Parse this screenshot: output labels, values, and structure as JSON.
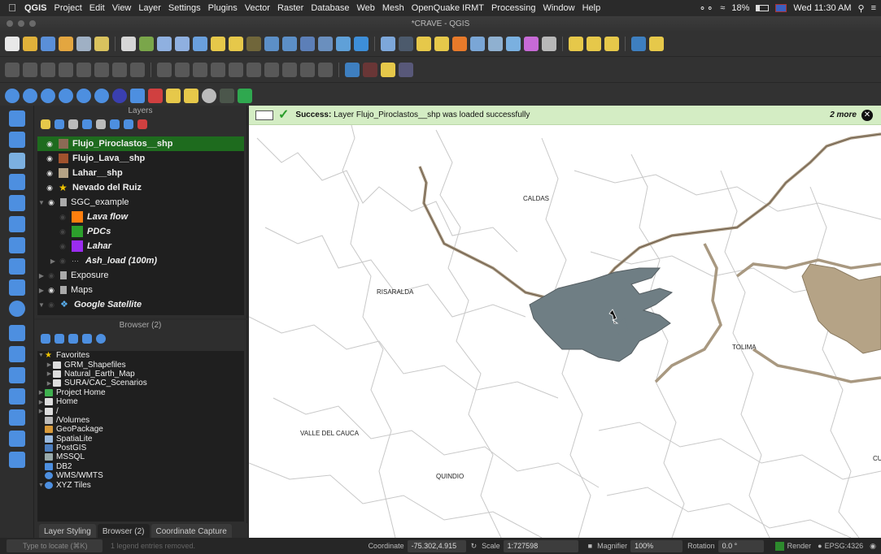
{
  "menubar": {
    "app_name": "QGIS",
    "items": [
      "Project",
      "Edit",
      "View",
      "Layer",
      "Settings",
      "Plugins",
      "Vector",
      "Raster",
      "Database",
      "Web",
      "Mesh",
      "OpenQuake IRMT",
      "Processing",
      "Window",
      "Help"
    ],
    "battery": "18%",
    "clock": "Wed 11:30 AM"
  },
  "window": {
    "title": "*CRAVE - QGIS"
  },
  "layers_panel": {
    "title": "Layers",
    "items": [
      {
        "label": "Flujo_Piroclastos__shp",
        "color": "#8c6a55",
        "selected": true
      },
      {
        "label": "Flujo_Lava__shp",
        "color": "#a0522d"
      },
      {
        "label": "Lahar__shp",
        "color": "#b5a386"
      },
      {
        "label": "Nevado del Ruiz",
        "color": "#f2c500"
      },
      {
        "label": "SGC_example"
      },
      {
        "label": "Lava flow",
        "color": "#ff7f0e"
      },
      {
        "label": "PDCs",
        "color": "#2ca02c"
      },
      {
        "label": "Lahar",
        "color": "#9b2cf0"
      },
      {
        "label": "Ash_load (100m)"
      },
      {
        "label": "Exposure"
      },
      {
        "label": "Maps"
      },
      {
        "label": "Google Satellite"
      }
    ]
  },
  "browser_panel": {
    "title": "Browser (2)",
    "items": [
      "Favorites",
      "GRM_Shapefiles",
      "Natural_Earth_Map",
      "SURA/CAC_Scenarios",
      "Project Home",
      "Home",
      "/",
      "/Volumes",
      "GeoPackage",
      "SpatiaLite",
      "PostGIS",
      "MSSQL",
      "DB2",
      "WMS/WMTS",
      "XYZ Tiles"
    ]
  },
  "bottom_tabs": [
    "Layer Styling",
    "Browser (2)",
    "Coordinate Capture"
  ],
  "message_bar": {
    "prefix": "Success:",
    "text": "Layer Flujo_Piroclastos__shp was loaded successfully",
    "more": "2 more"
  },
  "map": {
    "labels": [
      "CALDAS",
      "RISARALDA",
      "TOLIMA",
      "VALLE DEL CAUCA",
      "QUINDIO",
      "CU"
    ],
    "fill_colors": {
      "pyroclastic": "#6f7e84",
      "lahar": "#b5a386"
    }
  },
  "status": {
    "locate_placeholder": "Type to locate (⌘K)",
    "legend_info": "1 legend entries removed.",
    "coordinate_label": "Coordinate",
    "coordinate_value": "-75.302,4.915",
    "scale_label": "Scale",
    "scale_value": "1:727598",
    "magnifier_label": "Magnifier",
    "magnifier_value": "100%",
    "rotation_label": "Rotation",
    "rotation_value": "0.0 °",
    "render_label": "Render",
    "crs": "EPSG:4326"
  }
}
